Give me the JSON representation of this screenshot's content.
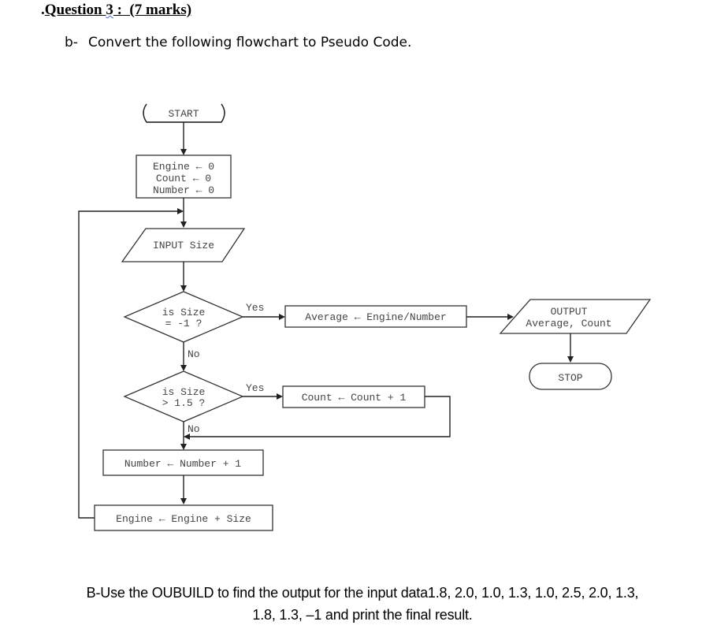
{
  "question": {
    "prefix": ".",
    "title_part1": "Question ",
    "title_number": "3",
    "title_part2": " :  (7 marks)"
  },
  "part_b1": {
    "label": "b-",
    "text": "Convert the following flowchart to Pseudo Code."
  },
  "flowchart": {
    "start": "START",
    "init": [
      "Engine ← 0",
      "Count ← 0",
      "Number ← 0"
    ],
    "input": "INPUT Size",
    "decision1": [
      "is Size",
      "= -1 ?"
    ],
    "decision1_yes": "Yes",
    "decision1_no": "No",
    "average": "Average ← Engine/Number",
    "output": [
      "OUTPUT",
      "Average, Count"
    ],
    "stop": "STOP",
    "decision2": [
      "is Size",
      "> 1.5 ?"
    ],
    "decision2_yes": "Yes",
    "decision2_no": "No",
    "count_inc": "Count ← Count + 1",
    "number_inc": "Number ← Number + 1",
    "engine_add": "Engine ← Engine + Size"
  },
  "part_b2": {
    "line1": "B-Use the OUBUILD to find the output for the input data1.8, 2.0, 1.0, 1.3, 1.0, 2.5, 2.0, 1.3,",
    "line2": "1.8, 1.3, –1 and print the final result."
  }
}
